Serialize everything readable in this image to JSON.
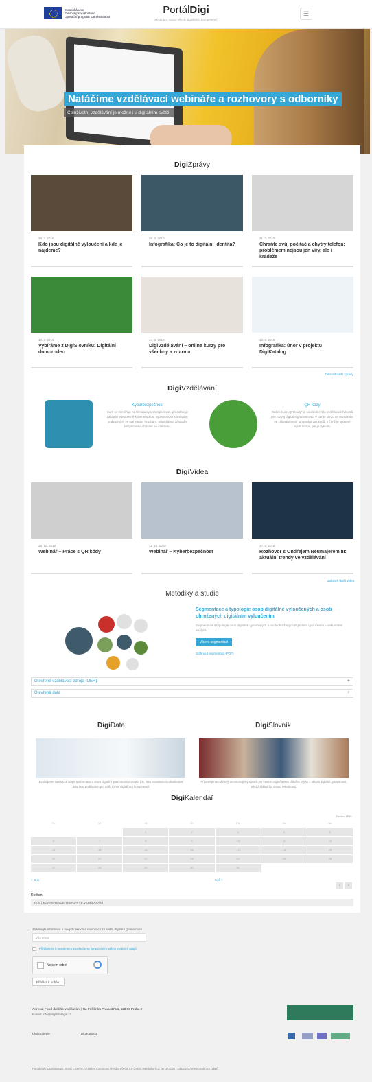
{
  "header": {
    "eu_lines": "Evropská unie\nEvropský sociální fond\nOperační program Zaměstnanost",
    "site_title_plain": "Portál",
    "site_title_bold": "Digi",
    "site_subtitle": "Místo pro rozvoj všech digitálních kompetencí",
    "menu_icon": "☰"
  },
  "hero": {
    "title": "Natáčíme vzdělávací webináře a rozhovory s odborníky",
    "subtitle": "Celoživotní vzdělávání je možné i v digitálním světě.",
    "slides": 6,
    "active_slide": 1
  },
  "digizpravy": {
    "heading_bold": "Digi",
    "heading_plain": "Zprávy",
    "cards": [
      {
        "date": "28. 3. 2019",
        "title": "Kdo jsou digitálně vyloučení a kde je najdeme?",
        "color": "#5a4a3a"
      },
      {
        "date": "26. 3. 2019",
        "title": "Infografika: Co je to digitální identita?",
        "color": "#3c5866"
      },
      {
        "date": "21. 3. 2019",
        "title": "Chraňte svůj počítač a chytrý telefon: problémem nejsou jen viry, ale i krádeže",
        "color": "#d6d6d6"
      },
      {
        "date": "19. 3. 2019",
        "title": "Vybíráme z DigiSlovníku: Digitální domorodec",
        "color": "#3a8a3a"
      },
      {
        "date": "14. 3. 2019",
        "title": "DigiVzdělávání – online kurzy pro všechny a zdarma",
        "color": "#e7e2dc"
      },
      {
        "date": "12. 3. 2019",
        "title": "Infografika: únor v projektu DigiKatalog",
        "color": "#eef3f7"
      }
    ],
    "more": "Zobrazit další zprávy"
  },
  "digivzdelavani": {
    "heading_bold": "Digi",
    "heading_plain": "Vzdělávání",
    "left": {
      "title": "Kyberbezpečnost",
      "text": "Kurz se zaměřuje na témata kyberbezpečnosti, představuje základní všeobecně kybernetickou, kybernetické kriminality, podvodných ve své situaci hrozbám, pravidlům a zásadám bezpečného chování na internetu."
    },
    "right": {
      "title": "QR kódy",
      "text": "Online kurz „QR kódy“ je součástí cyklu vzdělávacích kurzů pro rozvoj digitální gramotnosti. V tomto kurzu se seznámíte se základní teorií fungování QR kódů, s čímž je spojené jejich tvorba, jak je vytvořit."
    }
  },
  "digividea": {
    "heading_bold": "Digi",
    "heading_plain": "Videa",
    "cards": [
      {
        "date": "25. 10. 2018",
        "title": "Webinář – Práce s QR kódy"
      },
      {
        "date": "11. 10. 2018",
        "title": "Webinář – Kyberbezpečnost"
      },
      {
        "date": "27. 9. 2018",
        "title": "Rozhovor s Ondřejem Neumajerem III: aktuální trendy ve vzdělávání"
      }
    ],
    "more": "Zobrazit další videa"
  },
  "metodiky": {
    "heading": "Metodiky a studie",
    "title": "Segmentace a typologie osob digitálně vyloučených a osob ohrožených digitálním vyloučením",
    "text": "Segmentace a typologie osob digitálně vyloučených a osob ohrožených digitálním vyloučením – sekundární analýza.",
    "button": "Více o segmentaci",
    "link": "Stáhnout segmentaci (PDF)"
  },
  "accordions": [
    "Otevřené vzdělávací zdroje (OER)",
    "Otevřená data"
  ],
  "digidata": {
    "heading_bold": "Digi",
    "heading_plain": "Data",
    "text": "Evaluujeme statistické údaje a informace o stavu digitální gramotnosti obyvatel ČR. Tato kvantitativní a kvalitativní data jsou podkladem pro další rozvoj digitálních kompetencí."
  },
  "digislovnik": {
    "heading_bold": "Digi",
    "heading_plain": "Slovník",
    "text": "Připravujeme odborný terminologický slovník, ve kterém objasňujeme důležité pojmy z oblasti digitální gramotnosti, jejichž základ byl dosud nejednotný."
  },
  "kalendar": {
    "heading_bold": "Digi",
    "heading_plain": "Kalendář",
    "month": "Květen 2019",
    "days": [
      "Po",
      "Út",
      "St",
      "Čt",
      "Pá",
      "So",
      "Ne"
    ],
    "weeks": [
      [
        "",
        "",
        "1",
        "2",
        "3",
        "4",
        "5"
      ],
      [
        "6",
        "7",
        "8",
        "9",
        "10",
        "11",
        "12"
      ],
      [
        "13",
        "14",
        "15",
        "16",
        "17",
        "18",
        "19"
      ],
      [
        "20",
        "21",
        "22",
        "23",
        "24",
        "25",
        "26"
      ],
      [
        "27",
        "28",
        "29",
        "30",
        "31",
        "",
        ""
      ]
    ],
    "prev": "< Dub",
    "next": "Kvě >",
    "event_month": "Květen",
    "event": "22.5.  |  KONFERENCE TRENDY VE VZDĚLÁVÁNÍ"
  },
  "newsletter": {
    "label": "Získávejte informace o nových akcích a novinkách ze světa digitální gramotnosti",
    "placeholder": "Váš email",
    "consent": "Přihlášením k newsletteru souhlasíte se zpracováním vašich osobních údajů.",
    "captcha": "Nejsem robot",
    "button": "Přihlásit k odběru"
  },
  "contact": {
    "address": "Adresa: Fond dalšího vzdělávání | Na Poříčním Právu 376/1, 128 00 Praha 2",
    "email": "E-mail: info@digistrategie.cz"
  },
  "footer": {
    "copyright": "PortálDigi | DigiStrategie 2020 | Licence: Creative Commons Uveďte původ 3.0 Česká republika (CC BY 3.0 CZ) | Zásady ochrany osobních údajů",
    "logo1": "DigiStrategie",
    "logo2": "DigiKatalog"
  }
}
